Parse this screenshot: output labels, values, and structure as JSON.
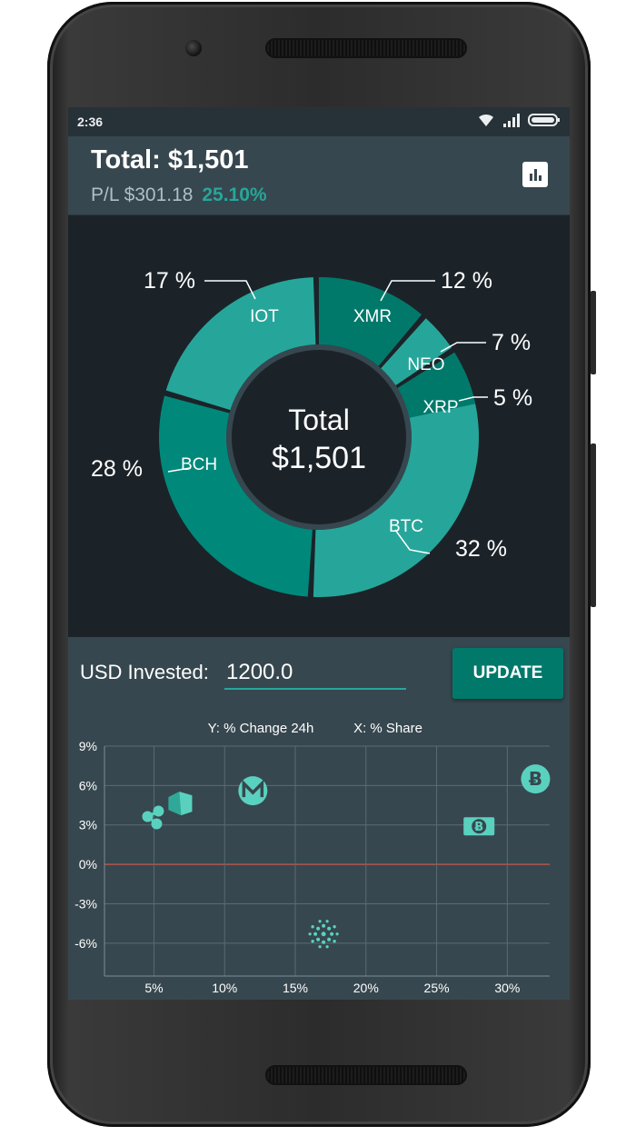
{
  "status_bar": {
    "time": "2:36"
  },
  "header": {
    "total": "Total: $1,501",
    "pl_prefix": "P/L $301.18",
    "pl_percent": "25.10%"
  },
  "donut": {
    "center_title": "Total",
    "center_value": "$1,501",
    "slices": [
      {
        "label": "BTC",
        "percent": "32 %",
        "color": "#26a69a"
      },
      {
        "label": "BCH",
        "percent": "28 %",
        "color": "#00897b"
      },
      {
        "label": "IOT",
        "percent": "17 %",
        "color": "#26a69a"
      },
      {
        "label": "XMR",
        "percent": "12 %",
        "color": "#00796b"
      },
      {
        "label": "NEO",
        "percent": "7 %",
        "color": "#26a69a"
      },
      {
        "label": "XRP",
        "percent": "5 %",
        "color": "#00796b"
      }
    ]
  },
  "invest": {
    "label": "USD Invested:",
    "value": "1200.0",
    "update_label": "UPDATE"
  },
  "chart_data": {
    "type": "scatter",
    "legend_y": "Y: % Change 24h",
    "legend_x": "X: % Share",
    "x_ticks": [
      "5%",
      "10%",
      "15%",
      "20%",
      "25%",
      "30%"
    ],
    "y_ticks": [
      "9%",
      "6%",
      "3%",
      "0%",
      "-3%",
      "-6%"
    ],
    "xlim": [
      1.5,
      33
    ],
    "ylim": [
      -8.5,
      9
    ],
    "zero_line_color": "#b0564e",
    "points": [
      {
        "symbol": "XRP",
        "icon": "ripple-icon",
        "x": 5,
        "y": 3.5
      },
      {
        "symbol": "NEO",
        "icon": "neo-icon",
        "x": 6.8,
        "y": 4.7
      },
      {
        "symbol": "XMR",
        "icon": "monero-icon",
        "x": 12,
        "y": 5.6
      },
      {
        "symbol": "IOT",
        "icon": "iota-icon",
        "x": 17,
        "y": -5.3
      },
      {
        "symbol": "BCH",
        "icon": "bitcoin-cash-icon",
        "x": 28,
        "y": 2.9
      },
      {
        "symbol": "BTC",
        "icon": "bitcoin-icon",
        "x": 32,
        "y": 6.5
      }
    ]
  }
}
